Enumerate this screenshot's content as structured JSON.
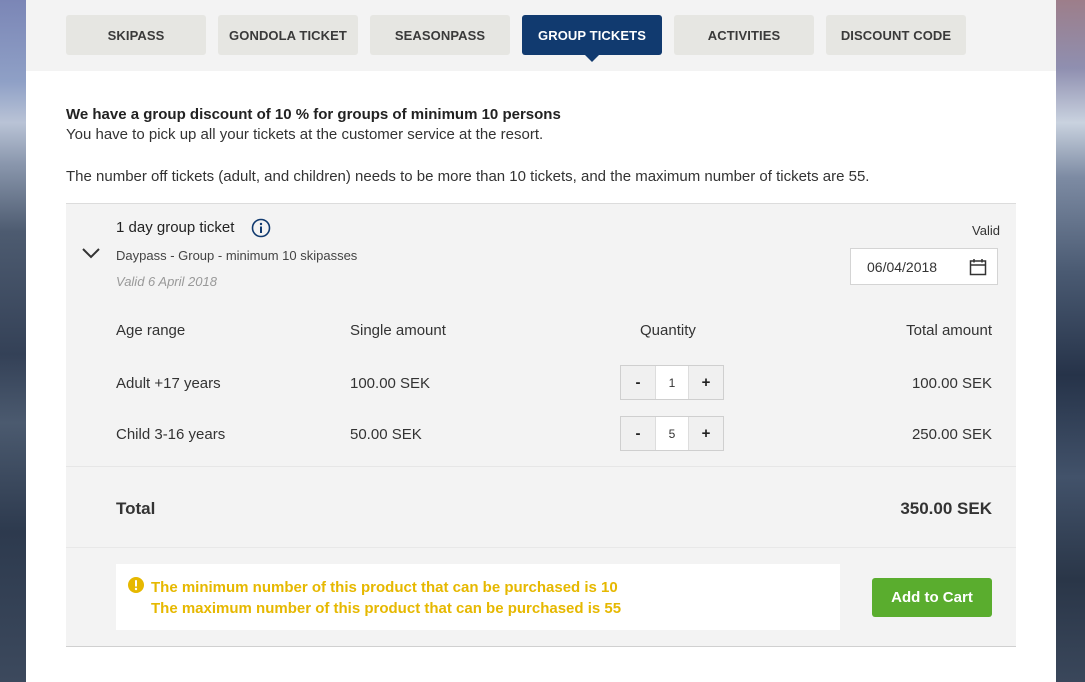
{
  "tabs": [
    {
      "label": "SKIPASS"
    },
    {
      "label": "GONDOLA TICKET"
    },
    {
      "label": "SEASONPASS"
    },
    {
      "label": "GROUP TICKETS",
      "active": true
    },
    {
      "label": "ACTIVITIES"
    },
    {
      "label": "DISCOUNT CODE"
    }
  ],
  "intro": {
    "line1": "We have a group discount of 10 % for groups of minimum 10 persons",
    "line2": "You have to pick up all your tickets at the customer service at the resort.",
    "line3": "The number off tickets (adult, and children) needs to be more than 10 tickets, and the maximum number of tickets are 55."
  },
  "product": {
    "name": "1 day group ticket",
    "description": "Daypass - Group - minimum 10 skipasses",
    "valid_text": "Valid 6 April 2018",
    "valid_label": "Valid",
    "date": "06/04/2018"
  },
  "table": {
    "headers": {
      "age": "Age range",
      "single": "Single amount",
      "quantity": "Quantity",
      "total": "Total amount"
    },
    "rows": [
      {
        "age": "Adult +17 years",
        "single": "100.00 SEK",
        "qty": "1",
        "total": "100.00 SEK"
      },
      {
        "age": "Child 3-16 years",
        "single": "50.00 SEK",
        "qty": "5",
        "total": "250.00 SEK"
      }
    ],
    "minus": "-",
    "plus": "+"
  },
  "total": {
    "label": "Total",
    "value": "350.00 SEK"
  },
  "warning": {
    "line1": "The minimum number of this product that can be purchased is 10",
    "line2": "The maximum number of this product that can be purchased is 55"
  },
  "cart_button": "Add to Cart",
  "colors": {
    "active_tab": "#113a6f",
    "warning": "#e6b800",
    "cart": "#5aad2e"
  }
}
